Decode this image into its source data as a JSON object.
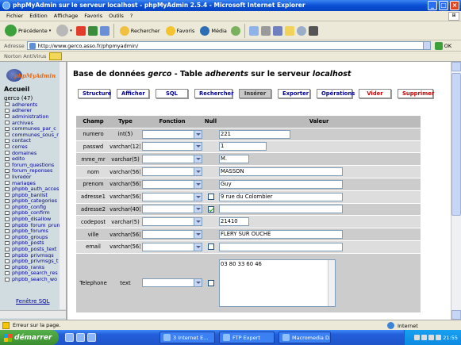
{
  "window": {
    "title": "phpMyAdmin sur le serveur localhost - phpMyAdmin 2.5.4 - Microsoft Internet Explorer"
  },
  "menu": [
    "Fichier",
    "Edition",
    "Affichage",
    "Favoris",
    "Outils",
    "?"
  ],
  "toolbar": {
    "back": "Précédente",
    "search": "Rechercher",
    "favorites": "Favoris",
    "media": "Média"
  },
  "address": {
    "label": "Adresse",
    "url": "http://www.gerco.asso.fr/phpmyadmin/",
    "go": "OK"
  },
  "norton": {
    "label": "Norton AntiVirus"
  },
  "left": {
    "logo": "phpMyAdmin",
    "home": "Accueil",
    "db": "gerco",
    "count": "(47)",
    "tables": [
      "adherents",
      "adherer",
      "administration",
      "archives",
      "communes_par_c",
      "communes_sous_r",
      "contact",
      "corres",
      "domaines",
      "edito",
      "forum_questions",
      "forum_reponses",
      "livredor",
      "mariages",
      "phpbb_auth_acces",
      "phpbb_banlist",
      "phpbb_categories",
      "phpbb_config",
      "phpbb_confirm",
      "phpbb_disallow",
      "phpbb_forum_prun",
      "phpbb_forums",
      "phpbb_groups",
      "phpbb_posts",
      "phpbb_posts_text",
      "phpbb_privmsgs",
      "phpbb_privmsgs_t",
      "phpbb_ranks",
      "phpbb_search_res",
      "phpbb_search_wo"
    ],
    "sql_window": "Fenêtre SQL"
  },
  "main": {
    "heading_prefix": "Base de données",
    "heading_db": "gerco",
    "heading_mid": "- Table",
    "heading_table": "adherents",
    "heading_suffix": "sur le serveur",
    "heading_server": "localhost",
    "tabs": [
      "Structure",
      "Afficher",
      "SQL",
      "Rechercher",
      "Insérer",
      "Exporter",
      "Opérations",
      "Vider",
      "Supprimer"
    ],
    "columns": [
      "Champ",
      "Type",
      "Fonction",
      "Null",
      "Valeur"
    ],
    "rows": [
      {
        "champ": "numero",
        "type": "int(5)",
        "valeur": "221",
        "null": false,
        "has_null": false
      },
      {
        "champ": "passwd",
        "type": "varchar(12)",
        "valeur": "1",
        "null": false,
        "has_null": false
      },
      {
        "champ": "mme_mr",
        "type": "varchar(5)",
        "valeur": "M.",
        "null": false,
        "has_null": false
      },
      {
        "champ": "nom",
        "type": "varchar(56)",
        "valeur": "MASSON",
        "null": false,
        "has_null": false
      },
      {
        "champ": "prenom",
        "type": "varchar(56)",
        "valeur": "Guy",
        "null": false,
        "has_null": false
      },
      {
        "champ": "adresse1",
        "type": "varchar(56)",
        "valeur": "9 rue du Colombier",
        "null": false,
        "has_null": true
      },
      {
        "champ": "adresse2",
        "type": "varchar(40)",
        "valeur": "",
        "null": true,
        "has_null": true
      },
      {
        "champ": "codepost",
        "type": "varchar(5)",
        "valeur": "21410",
        "null": false,
        "has_null": false
      },
      {
        "champ": "ville",
        "type": "varchar(56)",
        "valeur": "FLERY SUR OUCHE",
        "null": false,
        "has_null": false
      },
      {
        "champ": "email",
        "type": "varchar(56)",
        "valeur": "",
        "null": false,
        "has_null": true
      },
      {
        "champ": "Telephone",
        "type": "text",
        "valeur": "03 80 33 60 46",
        "null": false,
        "has_null": true
      }
    ]
  },
  "status": {
    "text": "Erreur sur la page.",
    "zone": "Internet"
  },
  "taskbar": {
    "start": "démarrer",
    "tasks": [
      "3 Internet E...",
      "FTP Expert",
      "Macromedia D..."
    ],
    "clock": "21:55"
  },
  "colors": {
    "title_bar": "#0a4fd6",
    "link": "#00009c",
    "danger_tab": "#cc0000",
    "table_bg": "#cccccc"
  }
}
